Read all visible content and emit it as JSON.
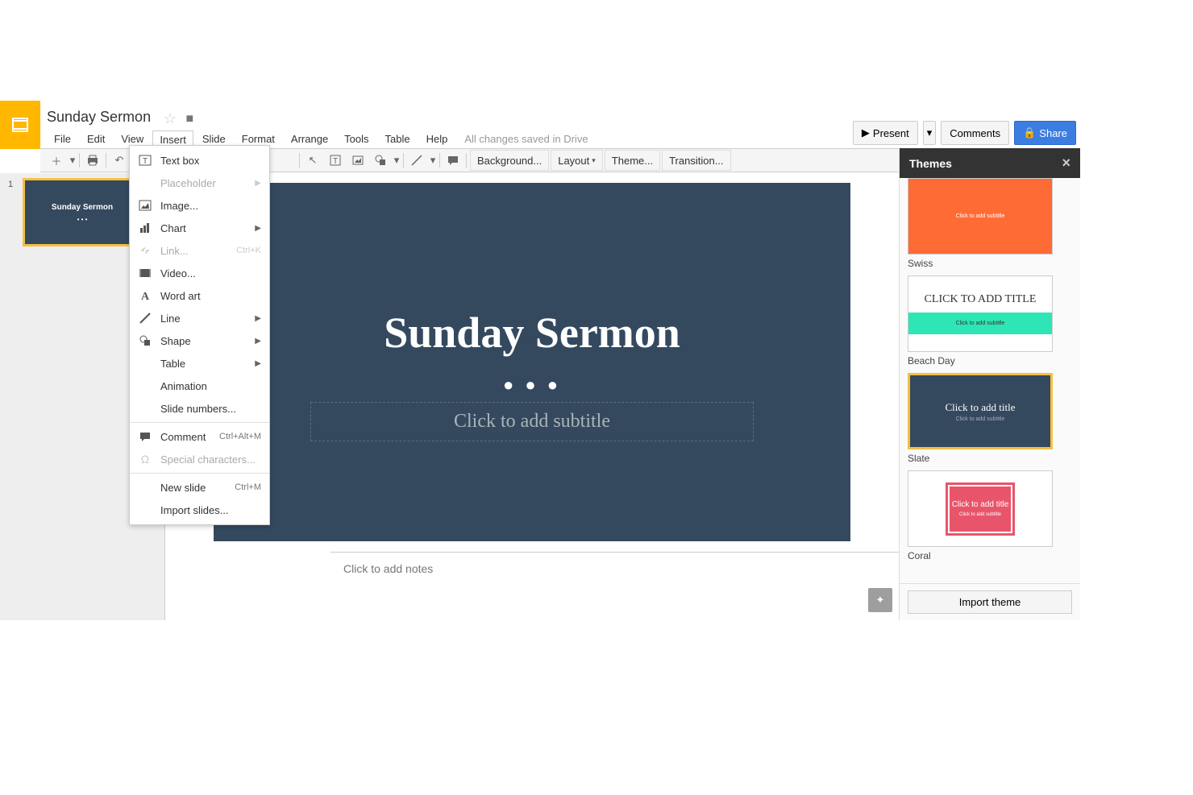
{
  "doc": {
    "title": "Sunday Sermon"
  },
  "save_status": "All changes saved in Drive",
  "menubar": [
    "File",
    "Edit",
    "View",
    "Insert",
    "Slide",
    "Format",
    "Arrange",
    "Tools",
    "Table",
    "Help"
  ],
  "active_menu_index": 3,
  "header_buttons": {
    "present": "Present",
    "comments": "Comments",
    "share": "Share"
  },
  "toolbar_wide": {
    "background": "Background...",
    "layout": "Layout",
    "theme": "Theme...",
    "transition": "Transition..."
  },
  "insert_menu": [
    {
      "label": "Text box",
      "icon": "textbox",
      "type": "item"
    },
    {
      "label": "Placeholder",
      "icon": "",
      "type": "submenu",
      "disabled": true
    },
    {
      "label": "Image...",
      "icon": "image",
      "type": "item"
    },
    {
      "label": "Chart",
      "icon": "chart",
      "type": "submenu"
    },
    {
      "label": "Link...",
      "icon": "link",
      "type": "item",
      "shortcut": "Ctrl+K",
      "disabled": true
    },
    {
      "label": "Video...",
      "icon": "video",
      "type": "item"
    },
    {
      "label": "Word art",
      "icon": "wordart",
      "type": "item"
    },
    {
      "label": "Line",
      "icon": "line",
      "type": "submenu"
    },
    {
      "label": "Shape",
      "icon": "shape",
      "type": "submenu"
    },
    {
      "label": "Table",
      "icon": "",
      "type": "submenu"
    },
    {
      "label": "Animation",
      "icon": "",
      "type": "item"
    },
    {
      "label": "Slide numbers...",
      "icon": "",
      "type": "item"
    },
    {
      "type": "sep"
    },
    {
      "label": "Comment",
      "icon": "comment",
      "type": "item",
      "shortcut": "Ctrl+Alt+M"
    },
    {
      "label": "Special characters...",
      "icon": "omega",
      "type": "item",
      "disabled": true
    },
    {
      "type": "sep"
    },
    {
      "label": "New slide",
      "icon": "",
      "type": "item",
      "shortcut": "Ctrl+M"
    },
    {
      "label": "Import slides...",
      "icon": "",
      "type": "item"
    }
  ],
  "filmstrip": {
    "slides": [
      {
        "number": "1",
        "title": "Sunday Sermon"
      }
    ]
  },
  "canvas": {
    "title": "Sunday Sermon",
    "subtitle_placeholder": "Click to add subtitle",
    "dots": "● ● ●"
  },
  "notes_placeholder": "Click to add notes",
  "themes_panel": {
    "title": "Themes",
    "import_btn": "Import theme",
    "themes": [
      {
        "name": "Swiss",
        "variant": "swiss"
      },
      {
        "name": "Beach Day",
        "variant": "beach",
        "preview_title": "CLICK TO ADD TITLE",
        "preview_sub": "Click to add subtitle"
      },
      {
        "name": "Slate",
        "variant": "slate",
        "selected": true,
        "preview_title": "Click to add title",
        "preview_sub": "Click to add subtitle"
      },
      {
        "name": "Coral",
        "variant": "coral",
        "preview_title": "Click to add title",
        "preview_sub": "Click to add subtitle"
      }
    ]
  }
}
